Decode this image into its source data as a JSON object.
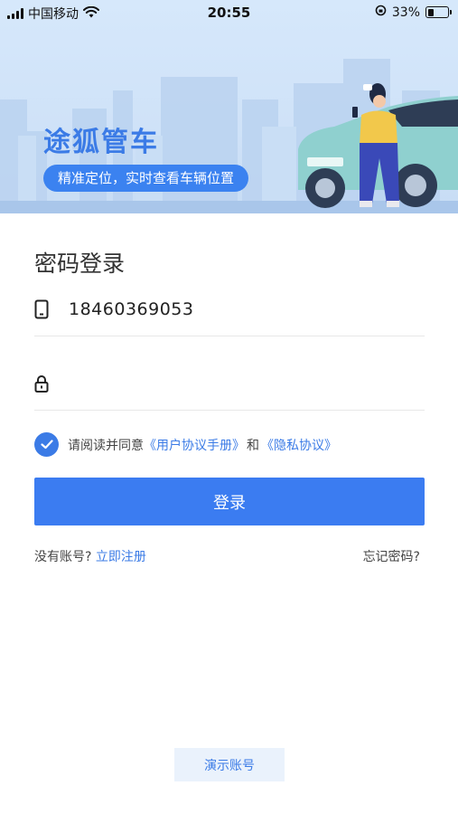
{
  "status_bar": {
    "carrier": "中国移动",
    "time": "20:55",
    "battery": "33%",
    "battery_level": 0.33
  },
  "banner": {
    "app_name": "途狐管车",
    "tagline": "精准定位，实时查看车辆位置"
  },
  "login": {
    "title": "密码登录",
    "phone_value": "18460369053",
    "password_value": "",
    "agree_prefix": "请阅读并同意",
    "user_agreement": "《用户协议手册》",
    "and_text": "和",
    "privacy_policy": "《隐私协议》",
    "agree_checked": true,
    "submit_label": "登录",
    "no_account": "没有账号?",
    "register_label": "立即注册",
    "forgot_label": "忘记密码?"
  },
  "demo_account_label": "演示账号",
  "colors": {
    "accent": "#3b7cf1",
    "banner_bg": "#d6e8fb"
  }
}
